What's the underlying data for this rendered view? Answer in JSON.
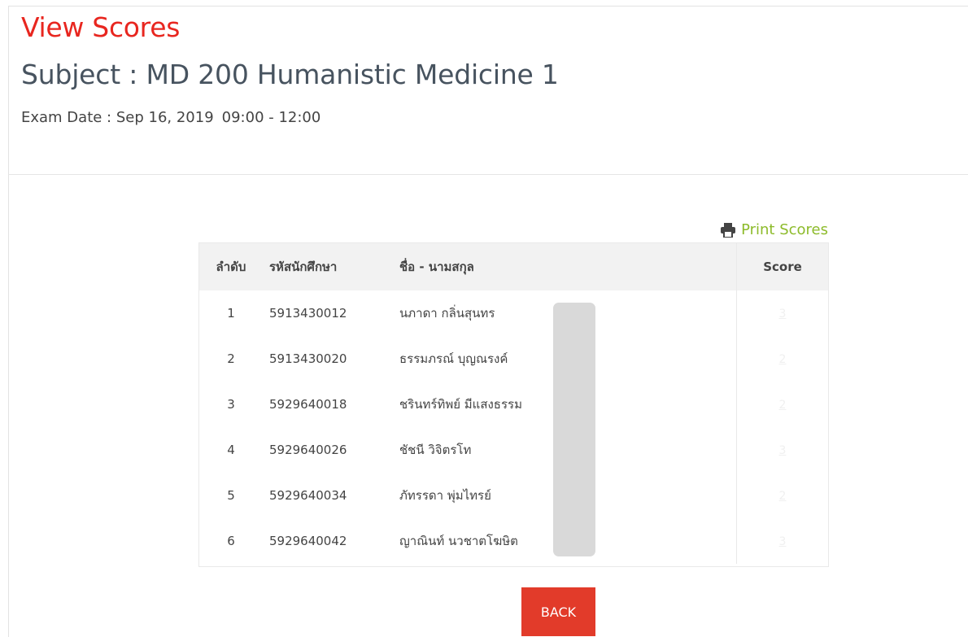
{
  "page": {
    "heading": "View Scores",
    "subject": "Subject : MD 200 Humanistic Medicine 1",
    "exam_date_label": "Exam Date : Sep 16, 2019",
    "exam_time": "09:00 - 12:00"
  },
  "toolbar": {
    "print_label": "Print Scores",
    "print_icon": "printer-icon"
  },
  "table": {
    "headers": {
      "number": "ลำดับ",
      "student_id": "รหัสนักศึกษา",
      "name": "ชื่อ - นามสกุล",
      "score": "Score"
    },
    "rows": [
      {
        "number": "1",
        "student_id": "5913430012",
        "name": "นภาดา กลิ่นสุนทร",
        "score": "3"
      },
      {
        "number": "2",
        "student_id": "5913430020",
        "name": "ธรรมภรณ์ บุญณรงค์",
        "score": "2"
      },
      {
        "number": "3",
        "student_id": "5929640018",
        "name": "ชรินทร์ทิพย์ มีแสงธรรม",
        "score": "2"
      },
      {
        "number": "4",
        "student_id": "5929640026",
        "name": "ชัชนี วิจิตรโท",
        "score": "3"
      },
      {
        "number": "5",
        "student_id": "5929640034",
        "name": "ภัทรรดา พุ่มไทรย์",
        "score": "2"
      },
      {
        "number": "6",
        "student_id": "5929640042",
        "name": "ญาณินท์ นวชาตโฆษิต",
        "score": "3"
      }
    ]
  },
  "actions": {
    "back_label": "BACK"
  },
  "colors": {
    "heading": "#e8261f",
    "link": "#8dbb2b",
    "back_button": "#e23b2a"
  }
}
